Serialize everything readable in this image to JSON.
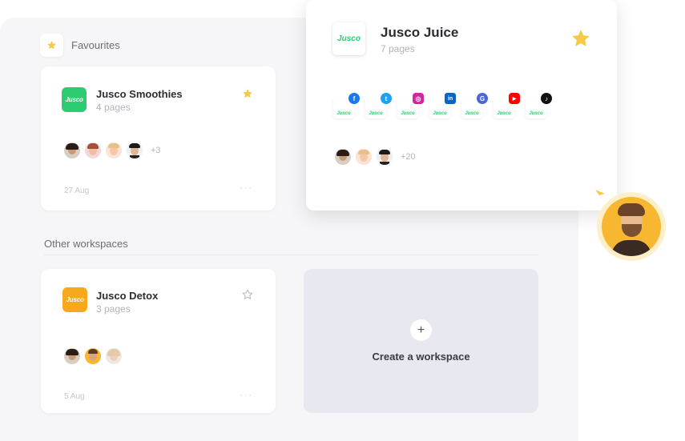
{
  "favourites": {
    "label": "Favourites"
  },
  "smoothies": {
    "logo_text": "Jusco",
    "title": "Jusco Smoothies",
    "pages": "4 pages",
    "more_count": "+3",
    "date": "27 Aug",
    "menu": "···"
  },
  "popup": {
    "logo_text": "Jusco",
    "title": "Jusco Juice",
    "pages": "7 pages",
    "more_count": "+20",
    "socials": [
      {
        "name": "facebook",
        "glyph": "f",
        "color": "#1877f2"
      },
      {
        "name": "twitter",
        "glyph": "t",
        "color": "#1da1f2"
      },
      {
        "name": "instagram",
        "glyph": "◎",
        "color": "#d6249f"
      },
      {
        "name": "linkedin",
        "glyph": "in",
        "color": "#0a66c2"
      },
      {
        "name": "google",
        "glyph": "G",
        "color": "#4a66d8"
      },
      {
        "name": "youtube",
        "glyph": "▶",
        "color": "#ff0000"
      },
      {
        "name": "tiktok",
        "glyph": "♪",
        "color": "#111111"
      }
    ],
    "mini_logo_text": "Jusco"
  },
  "other": {
    "label": "Other workspaces"
  },
  "detox": {
    "logo_text": "Jusco",
    "title": "Jusco Detox",
    "pages": "3 pages",
    "date": "5 Aug",
    "menu": "···"
  },
  "create": {
    "plus": "+",
    "label": "Create a workspace"
  },
  "colors": {
    "brand_green": "#2ecc71",
    "brand_orange": "#f6a91a",
    "star": "#f7c948"
  }
}
